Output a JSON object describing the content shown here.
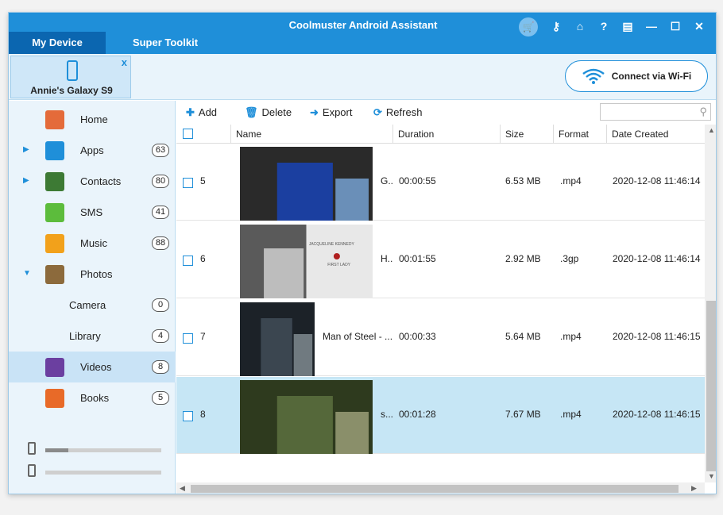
{
  "app": {
    "title": "Coolmuster Android Assistant"
  },
  "tabs": [
    {
      "label": "My Device"
    },
    {
      "label": "Super Toolkit"
    }
  ],
  "window_controls": [
    "cart-icon",
    "key-icon",
    "home-icon",
    "help-icon",
    "feedback-icon",
    "minimize-icon",
    "maximize-icon",
    "close-icon"
  ],
  "window_control_glyphs": {
    "key": "⚷",
    "home": "⌂",
    "help": "?",
    "feedback": "▤",
    "minimize": "—",
    "maximize": "☐",
    "close": "✕"
  },
  "device": {
    "name": "Annie's Galaxy S9",
    "close": "x"
  },
  "wifi_button": {
    "label": "Connect via Wi-Fi"
  },
  "sidebar": {
    "items": [
      {
        "label": "Home",
        "count": "",
        "arrow": "",
        "icon": "home-icon",
        "color": "#e46b3a"
      },
      {
        "label": "Apps",
        "count": "63",
        "arrow": "▶",
        "icon": "apps-icon",
        "color": "#1f8fd9"
      },
      {
        "label": "Contacts",
        "count": "80",
        "arrow": "▶",
        "icon": "contacts-icon",
        "color": "#3d7a34"
      },
      {
        "label": "SMS",
        "count": "41",
        "arrow": "",
        "icon": "sms-icon",
        "color": "#5cbc3c"
      },
      {
        "label": "Music",
        "count": "88",
        "arrow": "",
        "icon": "music-icon",
        "color": "#f2a11b"
      },
      {
        "label": "Photos",
        "count": "",
        "arrow": "▼",
        "icon": "photos-icon",
        "color": "#8c6a3c"
      },
      {
        "label": "Camera",
        "count": "0",
        "arrow": "",
        "icon": "",
        "color": ""
      },
      {
        "label": "Library",
        "count": "4",
        "arrow": "",
        "icon": "",
        "color": ""
      },
      {
        "label": "Videos",
        "count": "8",
        "arrow": "",
        "icon": "videos-icon",
        "color": "#6b3fa0"
      },
      {
        "label": "Books",
        "count": "5",
        "arrow": "",
        "icon": "books-icon",
        "color": "#e86a28"
      }
    ],
    "storage": [
      {
        "icon": "phone-storage-icon",
        "used_fraction": 0.2
      },
      {
        "icon": "sd-card-icon",
        "used_fraction": 0.0
      }
    ]
  },
  "toolbar": {
    "add": "Add",
    "delete": "Delete",
    "export": "Export",
    "refresh": "Refresh",
    "search_placeholder": ""
  },
  "table": {
    "columns": [
      "Name",
      "Duration",
      "Size",
      "Format",
      "Date Created"
    ],
    "rows": [
      {
        "index": "5",
        "name": "G...",
        "duration": "00:00:55",
        "size": "6.53 MB",
        "format": ".mp4",
        "date": "2020-12-08 11:46:14",
        "thumb_colors": [
          "#2a2a2a",
          "#1b3fa0",
          "#6a8fb8"
        ]
      },
      {
        "index": "6",
        "name": "H...",
        "duration": "00:01:55",
        "size": "2.92 MB",
        "format": ".3gp",
        "date": "2020-12-08 11:46:14",
        "thumb_colors": [
          "#5a5a5a",
          "#bdbdbd",
          "#e8e8e8"
        ],
        "thumb_text": "JACQUELINE KENNEDY",
        "thumb_text2": "FIRST LADY"
      },
      {
        "index": "7",
        "name": "Man of Steel - ...",
        "duration": "00:00:33",
        "size": "5.64 MB",
        "format": ".mp4",
        "date": "2020-12-08 11:46:15",
        "thumb_colors": [
          "#1c2228",
          "#3b4650",
          "#707a80"
        ]
      },
      {
        "index": "8",
        "name": "s...",
        "duration": "00:01:28",
        "size": "7.67 MB",
        "format": ".mp4",
        "date": "2020-12-08 11:46:15",
        "thumb_colors": [
          "#2e3a1e",
          "#55683a",
          "#8a8f6a"
        ]
      }
    ],
    "selected_row": "8"
  }
}
